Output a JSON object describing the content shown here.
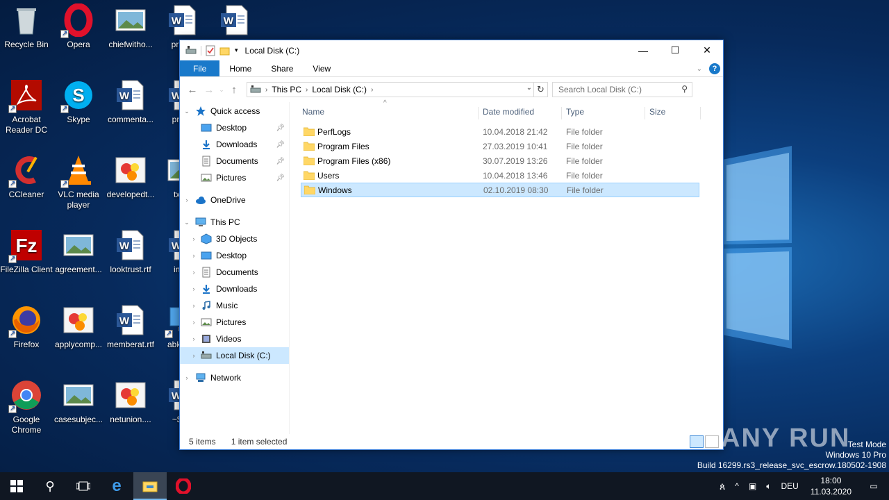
{
  "desktop": {
    "icons": [
      {
        "label": "Recycle Bin",
        "icon": "recycle-bin-icon"
      },
      {
        "label": "Opera",
        "icon": "opera-icon"
      },
      {
        "label": "chiefwitho...",
        "icon": "image-file-icon"
      },
      {
        "label": "priceh",
        "icon": "word-doc-icon"
      },
      {
        "label": "",
        "icon": "word-doc-icon"
      },
      {
        "label": "Acrobat Reader DC",
        "icon": "acrobat-icon"
      },
      {
        "label": "Skype",
        "icon": "skype-icon"
      },
      {
        "label": "commenta...",
        "icon": "word-doc-icon"
      },
      {
        "label": "produ",
        "icon": "word-doc-icon"
      },
      {
        "label": "CCleaner",
        "icon": "ccleaner-icon"
      },
      {
        "label": "VLC media player",
        "icon": "vlc-icon"
      },
      {
        "label": "developedt...",
        "icon": "paint-file-icon"
      },
      {
        "label": "txma",
        "icon": "image-file-icon"
      },
      {
        "label": "FileZilla Client",
        "icon": "filezilla-icon"
      },
      {
        "label": "agreement...",
        "icon": "image-file-icon"
      },
      {
        "label": "looktrust.rtf",
        "icon": "word-doc-icon"
      },
      {
        "label": "info_",
        "icon": "word-doc-icon"
      },
      {
        "label": "Firefox",
        "icon": "firefox-icon"
      },
      {
        "label": "applycomp...",
        "icon": "paint-file-icon"
      },
      {
        "label": "memberat.rtf",
        "icon": "word-doc-icon"
      },
      {
        "label": "abk Sho",
        "icon": "computer-icon"
      },
      {
        "label": "Google Chrome",
        "icon": "chrome-icon"
      },
      {
        "label": "casesubjec...",
        "icon": "image-file-icon"
      },
      {
        "label": "netunion....",
        "icon": "paint-file-icon"
      },
      {
        "label": "~$fo_",
        "icon": "word-doc-icon"
      }
    ]
  },
  "explorer": {
    "title": "Local Disk (C:)",
    "ribbon_tabs": [
      "File",
      "Home",
      "Share",
      "View"
    ],
    "address": {
      "crumbs": [
        "This PC",
        "Local Disk (C:)"
      ]
    },
    "search_placeholder": "Search Local Disk (C:)",
    "nav": {
      "quick_access": "Quick access",
      "qa_items": [
        "Desktop",
        "Downloads",
        "Documents",
        "Pictures"
      ],
      "onedrive": "OneDrive",
      "this_pc": "This PC",
      "pc_items": [
        "3D Objects",
        "Desktop",
        "Documents",
        "Downloads",
        "Music",
        "Pictures",
        "Videos",
        "Local Disk (C:)"
      ],
      "network": "Network"
    },
    "columns": [
      "Name",
      "Date modified",
      "Type",
      "Size"
    ],
    "files": [
      {
        "name": "PerfLogs",
        "date": "10.04.2018 21:42",
        "type": "File folder"
      },
      {
        "name": "Program Files",
        "date": "27.03.2019 10:41",
        "type": "File folder"
      },
      {
        "name": "Program Files (x86)",
        "date": "30.07.2019 13:26",
        "type": "File folder"
      },
      {
        "name": "Users",
        "date": "10.04.2018 13:46",
        "type": "File folder"
      },
      {
        "name": "Windows",
        "date": "02.10.2019 08:30",
        "type": "File folder"
      }
    ],
    "status": {
      "count": "5 items",
      "selected": "1 item selected"
    }
  },
  "watermark": {
    "line1": "Test Mode",
    "line2": "Windows 10 Pro",
    "line3": "Build 16299.rs3_release_svc_escrow.180502-1908",
    "brand": "ANY RUN"
  },
  "taskbar": {
    "lang": "DEU",
    "time": "18:00",
    "date": "11.03.2020"
  }
}
